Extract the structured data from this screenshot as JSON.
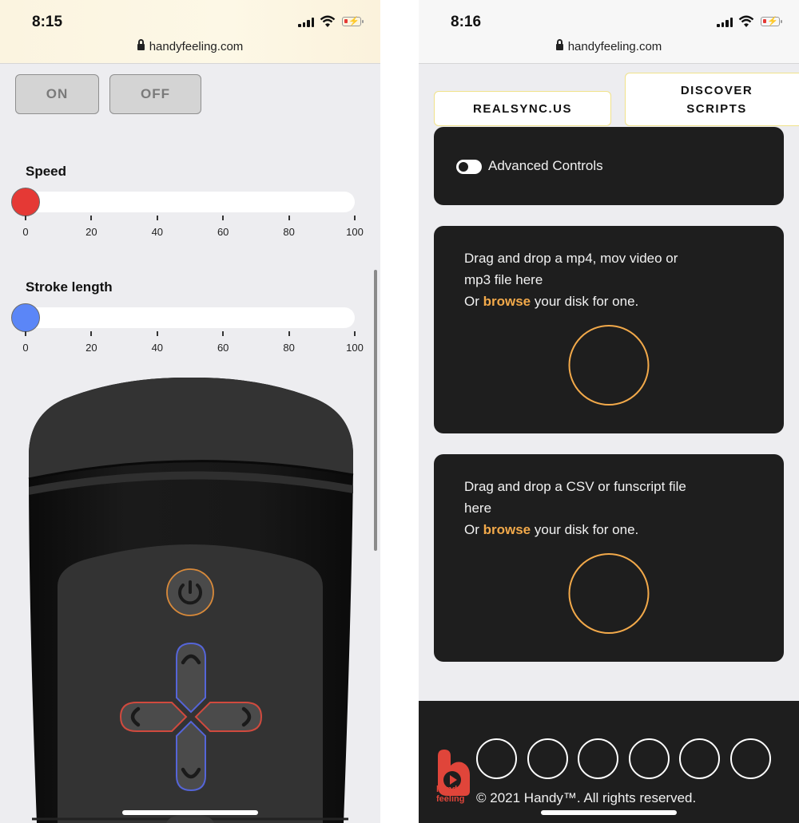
{
  "left_screen": {
    "status": {
      "time": "8:15",
      "url": "handyfeeling.com",
      "battery_charging": true
    },
    "buttons": {
      "on_label": "ON",
      "off_label": "OFF"
    },
    "sliders": [
      {
        "label": "Speed",
        "value": 0,
        "min": 0,
        "max": 100,
        "ticks": [
          "0",
          "20",
          "40",
          "60",
          "80",
          "100"
        ],
        "knob_color": "#e53935"
      },
      {
        "label": "Stroke length",
        "value": 0,
        "min": 0,
        "max": 100,
        "ticks": [
          "0",
          "20",
          "40",
          "60",
          "80",
          "100"
        ],
        "knob_color": "#5b86f7"
      }
    ],
    "device": {
      "power_button": "power-icon",
      "dpad": {
        "up": "chevron-up-icon",
        "down": "chevron-down-icon",
        "left": "chevron-left-icon",
        "right": "chevron-right-icon"
      },
      "colors": {
        "power_ring": "#d98a3a",
        "vertical_ring": "#5565d8",
        "horizontal_ring": "#d04a3e"
      }
    }
  },
  "right_screen": {
    "status": {
      "time": "8:16",
      "url": "handyfeeling.com",
      "battery_charging": true
    },
    "tabs": [
      {
        "label": "REALSYNC.US"
      },
      {
        "label_line1": "DISCOVER",
        "label_line2": "SCRIPTS"
      }
    ],
    "advanced_controls": {
      "label": "Advanced Controls",
      "enabled": false
    },
    "video_drop": {
      "line1": "Drag and drop a mp4, mov video or",
      "line2": "mp3 file here",
      "prefix": "Or ",
      "link": "browse",
      "suffix": " your disk for one."
    },
    "script_drop": {
      "line1": "Drag and drop a CSV or funscript file",
      "line2": "here",
      "prefix": "Or ",
      "link": "browse",
      "suffix": " your disk for one."
    },
    "footer": {
      "logo_line1": "handy",
      "logo_line2": "feeling",
      "social_count": 6,
      "copyright": "© 2021 Handy™. All rights reserved."
    },
    "accent_color": "#f2a94a"
  }
}
